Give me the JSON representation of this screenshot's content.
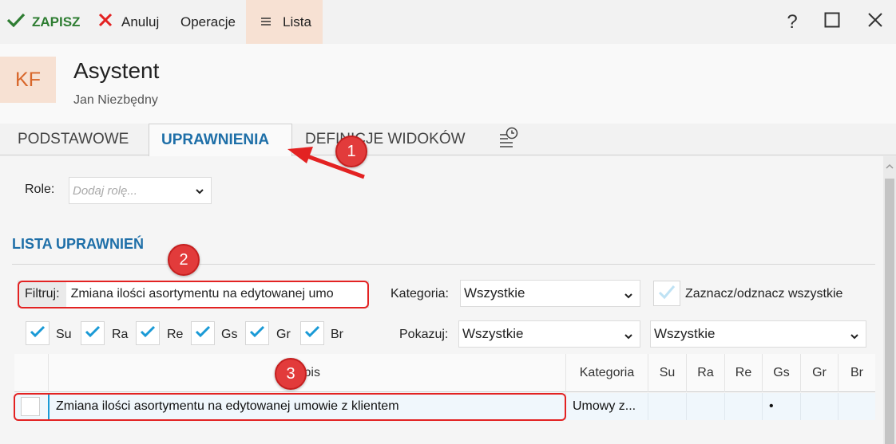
{
  "toolbar": {
    "save_label": "ZAPISZ",
    "cancel_label": "Anuluj",
    "operations_label": "Operacje",
    "list_label": "Lista",
    "help_label": "?"
  },
  "header": {
    "avatar_initials": "KF",
    "title": "Asystent",
    "subtitle": "Jan Niezbędny"
  },
  "tabs": [
    {
      "label": "PODSTAWOWE",
      "active": false
    },
    {
      "label": "UPRAWNIENIA",
      "active": true
    },
    {
      "label": "DEFINICJE WIDOKÓW",
      "active": false
    }
  ],
  "roles": {
    "label": "Role:",
    "placeholder": "Dodaj rolę..."
  },
  "permissions": {
    "section_title": "LISTA UPRAWNIEŃ",
    "filter_label": "Filtruj:",
    "filter_value": "Zmiana ilości asortymentu na edytowanej umo",
    "category_label": "Kategoria:",
    "category_value": "Wszystkie",
    "toggle_all_label": "Zaznacz/odznacz wszystkie",
    "show_label": "Pokazuj:",
    "show_value": "Wszystkie",
    "show_value_2": "Wszystkie",
    "flags": [
      {
        "label": "Su",
        "checked": true
      },
      {
        "label": "Ra",
        "checked": true
      },
      {
        "label": "Re",
        "checked": true
      },
      {
        "label": "Gs",
        "checked": true
      },
      {
        "label": "Gr",
        "checked": true
      },
      {
        "label": "Br",
        "checked": true
      }
    ]
  },
  "table": {
    "columns": [
      "Opis",
      "Kategoria",
      "Su",
      "Ra",
      "Re",
      "Gs",
      "Gr",
      "Br"
    ],
    "rows": [
      {
        "checked": false,
        "opis": "Zmiana ilości asortymentu na edytowanej umowie z klientem",
        "kategoria": "Umowy z...",
        "su": "",
        "ra": "",
        "re": "",
        "gs": "•",
        "gr": "",
        "br": ""
      }
    ]
  },
  "annotations": [
    "1",
    "2",
    "3"
  ],
  "colors": {
    "accent": "#1e6fa8",
    "save_green": "#2e7d32",
    "cancel_red": "#e32222",
    "avatar_bg": "#f7e1d3",
    "avatar_text": "#d8662a",
    "annotation_red": "#e23b3b"
  }
}
